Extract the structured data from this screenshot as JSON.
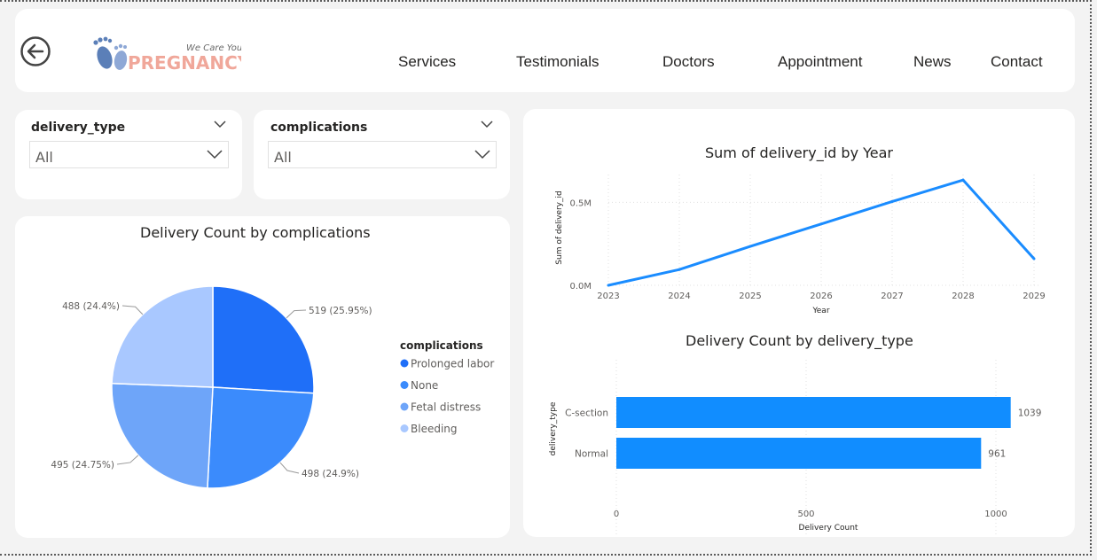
{
  "header": {
    "logo": {
      "tagline": "We Care You",
      "brand": "PREGNANCY"
    },
    "nav": [
      "Services",
      "Testimonials",
      "Doctors",
      "Appointment",
      "News",
      "Contact"
    ]
  },
  "slicers": [
    {
      "title": "delivery_type",
      "value": "All"
    },
    {
      "title": "complications",
      "value": "All"
    }
  ],
  "colors": {
    "pie": [
      "#1f6ff8",
      "#3b8bfc",
      "#6ea5f9",
      "#a9c8ff"
    ],
    "line": "#1a8cff",
    "bar": "#118dff"
  },
  "chart_data": [
    {
      "type": "pie",
      "title": "Delivery Count by complications",
      "legend_title": "complications",
      "legend_position": "right",
      "slices": [
        {
          "label": "Prolonged labor",
          "value": 519,
          "data_label": "519 (25.95%)"
        },
        {
          "label": "None",
          "value": 498,
          "data_label": "498 (24.9%)"
        },
        {
          "label": "Fetal distress",
          "value": 495,
          "data_label": "495 (24.75%)"
        },
        {
          "label": "Bleeding",
          "value": 488,
          "data_label": "488 (24.4%)"
        }
      ]
    },
    {
      "type": "line",
      "title": "Sum of delivery_id by Year",
      "xlabel": "Year",
      "ylabel": "Sum of delivery_id",
      "x": [
        "2023",
        "2024",
        "2025",
        "2026",
        "2027",
        "2028",
        "2029"
      ],
      "values": [
        0,
        95000,
        235000,
        370000,
        505000,
        635000,
        160000
      ],
      "y_ticks": [
        "0.0M",
        "0.5M"
      ],
      "ylim": [
        0,
        700000
      ],
      "grid": true
    },
    {
      "type": "bar",
      "orientation": "horizontal",
      "title": "Delivery Count by delivery_type",
      "xlabel": "Delivery Count",
      "ylabel": "delivery_type",
      "categories": [
        "C-section",
        "Normal"
      ],
      "values": [
        1039,
        961
      ],
      "x_ticks": [
        "0",
        "500",
        "1000"
      ],
      "xlim": [
        0,
        1080
      ],
      "grid": true
    }
  ]
}
